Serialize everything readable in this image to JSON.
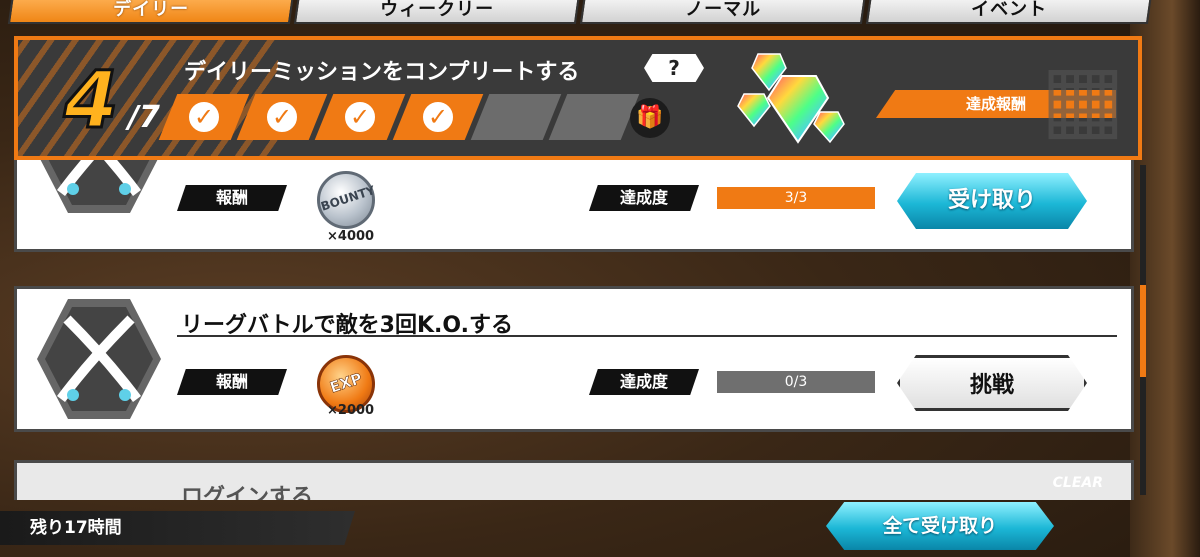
{
  "tabs": [
    {
      "label": "デイリー",
      "active": true
    },
    {
      "label": "ウィークリー",
      "active": false
    },
    {
      "label": "ノーマル",
      "active": false
    },
    {
      "label": "イベント",
      "active": false
    }
  ],
  "complete_mission": {
    "count": "4",
    "total": "/7",
    "title": "デイリーミッションをコンプリートする",
    "help_label": "?",
    "completed_slots": 4,
    "total_slots": 7,
    "reward_label": "達成報酬"
  },
  "missions": [
    {
      "title": "",
      "reward_tag": "報酬",
      "reward_coin": "BOUNTY",
      "reward_qty": "×4000",
      "progress_tag": "達成度",
      "progress_text": "3/3",
      "progress_value": 1.0,
      "button_label": "受け取り"
    },
    {
      "title": "リーグバトルで敵を3回K.O.する",
      "reward_tag": "報酬",
      "reward_coin": "EXP",
      "reward_qty": "×2000",
      "progress_tag": "達成度",
      "progress_text": "0/3",
      "progress_value": 0.0,
      "button_label": "挑戦"
    },
    {
      "title": "ログインする",
      "clear_label": "CLEAR"
    }
  ],
  "footer": {
    "time_left": "残り17時間",
    "claim_all_label": "全て受け取り"
  },
  "colors": {
    "accent": "#f07a14",
    "cyan": "#1cb7d6",
    "panel": "#3a3a3a"
  }
}
